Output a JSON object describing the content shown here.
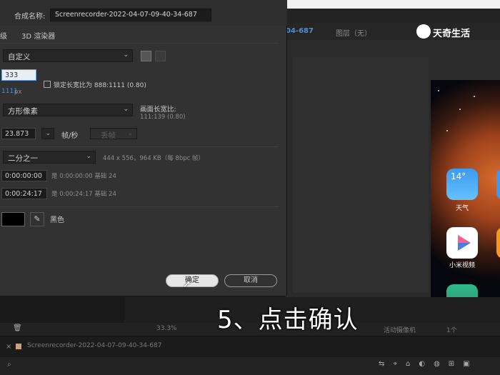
{
  "dialog": {
    "name_label": "合成名称:",
    "name_value": "Screenrecorder-2022-04-07-09-40-34-687",
    "tabs": [
      "级",
      "3D 渲染器"
    ],
    "preset": "自定义",
    "width_value": "333",
    "height_value": "1111",
    "height_unit": "px",
    "lock_aspect_label": "锁定长宽比为 888:1111 (0.80)",
    "pixel_aspect": "方形像素",
    "frame_aspect_label": "画面长宽比:",
    "frame_aspect_value": "111:139 (0.80)",
    "frame_rate": "23.873",
    "frame_rate_unit": "帧/秒",
    "drop_frame": "丢帧",
    "resolution": "二分之一",
    "resolution_info": "444 x 556，964 KB（每 8bpc 帧）",
    "start_timecode": "0:00:00:00",
    "start_info": "是 0:00:00:00  基础 24",
    "duration": "0:00:24:17",
    "duration_info": "是 0:00:24:17  基础 24",
    "bg_color_label": "黑色",
    "ok_label": "确定",
    "cancel_label": "取消"
  },
  "viewer": {
    "comp_tab": "04-687",
    "layer_tab": "图层（无）",
    "zoom": "33.3%",
    "camera": "活动摄像机",
    "views": "1个",
    "phone_apps": [
      {
        "label": "天气",
        "badge": "14°"
      },
      {
        "label": "小米视频",
        "badge": ""
      }
    ]
  },
  "timeline": {
    "tab_name": "Screenrecorder-2022-04-07-09-40-34-687"
  },
  "caption": "5、点击确认",
  "watermark": "天奇生活",
  "colors": {
    "accent_blue": "#4a8fd8",
    "dialog_bg": "#323232",
    "caption": "#ffffff"
  }
}
